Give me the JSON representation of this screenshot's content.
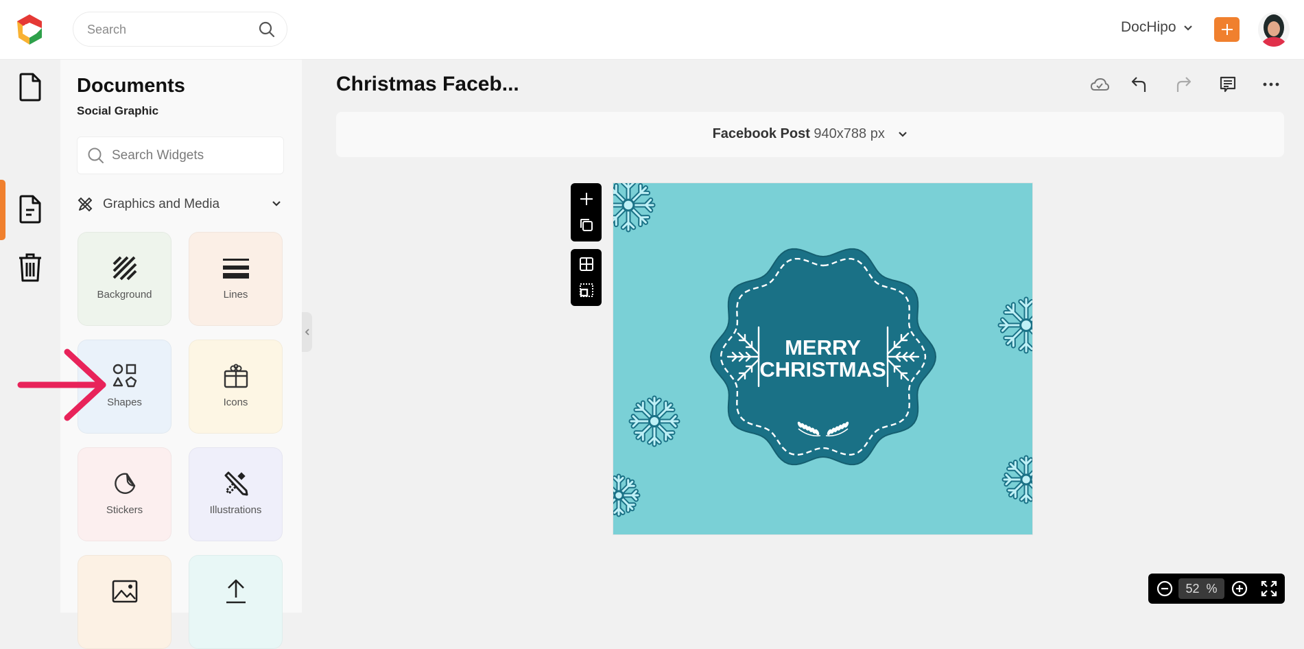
{
  "topbar": {
    "search_placeholder": "Search",
    "workspace_label": "DocHipo",
    "brand_color": "#f0802e"
  },
  "rail": {
    "items": [
      {
        "name": "new-document",
        "icon": "document-icon"
      },
      {
        "name": "documents",
        "icon": "document-text-icon",
        "active": true
      },
      {
        "name": "trash",
        "icon": "trash-icon"
      }
    ]
  },
  "panel": {
    "title": "Documents",
    "subtitle": "Social Graphic",
    "search_placeholder": "Search Widgets",
    "section_label": "Graphics and Media",
    "tiles": [
      {
        "label": "Background",
        "icon": "background-icon",
        "color": "#eef4ec"
      },
      {
        "label": "Lines",
        "icon": "lines-icon",
        "color": "#fbefe6"
      },
      {
        "label": "Shapes",
        "icon": "shapes-icon",
        "color": "#eaf2fa"
      },
      {
        "label": "Icons",
        "icon": "gift-icon",
        "color": "#fdf6e4"
      },
      {
        "label": "Stickers",
        "icon": "sticker-icon",
        "color": "#fcefef"
      },
      {
        "label": "Illustrations",
        "icon": "illustration-icon",
        "color": "#efeffa"
      },
      {
        "label": "",
        "icon": "image-icon",
        "color": "#fcf1e4"
      },
      {
        "label": "",
        "icon": "upload-icon",
        "color": "#e8f7f6"
      }
    ]
  },
  "document": {
    "title": "Christmas Faceb...",
    "format_name": "Facebook Post",
    "format_size": "940x788 px"
  },
  "canvas": {
    "line1": "MERRY",
    "line2": "CHRISTMAS",
    "background_color": "#7ad0d6",
    "badge_color": "#1a7186"
  },
  "zoom": {
    "value": "52",
    "unit": "%"
  },
  "annotation": {
    "arrow_color": "#e8235a",
    "points_to": "Shapes"
  }
}
